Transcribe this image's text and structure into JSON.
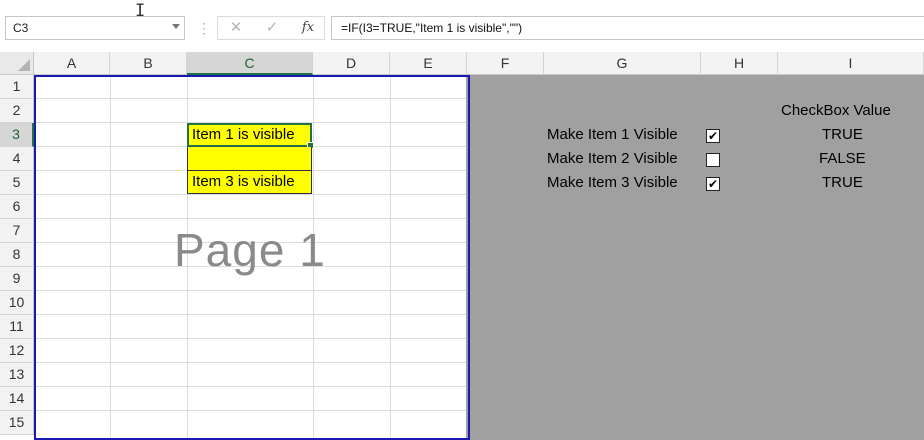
{
  "formula_bar": {
    "name_box": "C3",
    "cancel_icon": "✕",
    "enter_icon": "✓",
    "fx_label": "fx",
    "formula": "=IF(I3=TRUE,\"Item 1 is visible\",\"\")"
  },
  "columns": [
    "A",
    "B",
    "C",
    "D",
    "E",
    "F",
    "G",
    "H",
    "I"
  ],
  "selected_column": "C",
  "rows": [
    "1",
    "2",
    "3",
    "4",
    "5",
    "6",
    "7",
    "8",
    "9",
    "10",
    "11",
    "12",
    "13",
    "14",
    "15"
  ],
  "selected_row": "3",
  "cells": {
    "C3": "Item 1 is visible",
    "C4": "",
    "C5": "Item 3 is visible"
  },
  "watermark": "Page 1",
  "checkbox_panel": {
    "header": "CheckBox Value",
    "items": [
      {
        "label": "Make Item 1 Visible",
        "checked": true,
        "value": "TRUE"
      },
      {
        "label": "Make Item 2 Visible",
        "checked": false,
        "value": "FALSE"
      },
      {
        "label": "Make Item 3 Visible",
        "checked": true,
        "value": "TRUE"
      }
    ]
  },
  "colors": {
    "cell_fill": "#ffff00",
    "selection": "#217346",
    "page_border": "#1a1ab0",
    "outside_print_area": "#a0a0a0"
  }
}
